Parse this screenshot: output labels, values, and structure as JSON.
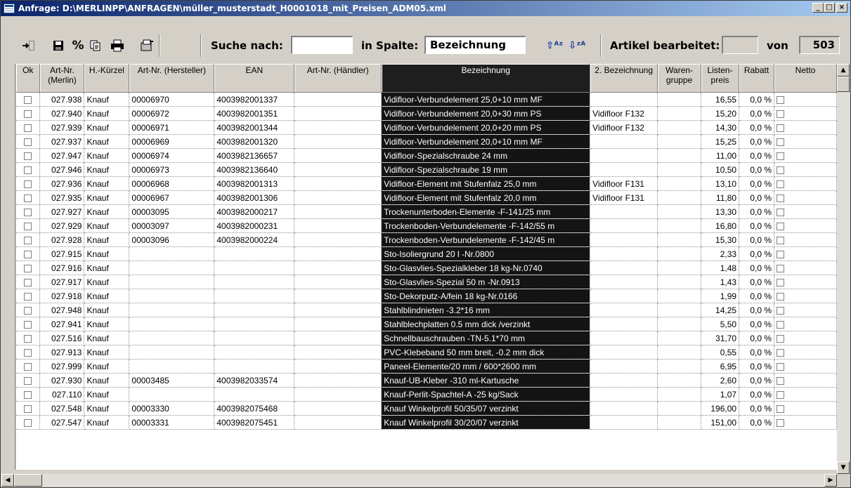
{
  "window": {
    "title": "Anfrage: D:\\MERLINPP\\ANFRAGEN\\müller_musterstadt_H0001018_mit_Preisen_ADM05.xml"
  },
  "toolbar": {
    "search_label": "Suche nach:",
    "search_value": "",
    "column_label": "in Spalte:",
    "column_value": "Bezeichnung",
    "edited_label": "Artikel bearbeitet:",
    "edited_value": "",
    "of_label": "von",
    "total": "503",
    "icons": [
      "exit-icon",
      "save-icon",
      "percent-icon",
      "copy-icon",
      "print-icon",
      "export-icon",
      "sort-ascending-icon",
      "sort-descending-icon"
    ]
  },
  "grid": {
    "columns": [
      "Ok",
      "Art-Nr. (Merlin)",
      "H.-Kürzel",
      "Art-Nr. (Hersteller)",
      "EAN",
      "Art-Nr. (Händler)",
      "Bezeichnung",
      "2. Bezeichnung",
      "Waren- gruppe",
      "Listen- preis",
      "Rabatt",
      "Netto"
    ],
    "rows": [
      {
        "art": "027.938",
        "hk": "Knauf",
        "hersteller": "00006970",
        "ean": "4003982001337",
        "haendler": "",
        "bez": "Vidifloor-Verbundelement 25,0+10 mm MF",
        "bez2": "",
        "wg": "",
        "preis": "16,55",
        "rabatt": "0,0 %"
      },
      {
        "art": "027.940",
        "hk": "Knauf",
        "hersteller": "00006972",
        "ean": "4003982001351",
        "haendler": "",
        "bez": "Vidifloor-Verbundelement 20,0+30 mm PS",
        "bez2": "Vidifloor F132",
        "wg": "",
        "preis": "15,20",
        "rabatt": "0,0 %"
      },
      {
        "art": "027.939",
        "hk": "Knauf",
        "hersteller": "00006971",
        "ean": "4003982001344",
        "haendler": "",
        "bez": "Vidifloor-Verbundelement 20,0+20 mm PS",
        "bez2": "Vidifloor F132",
        "wg": "",
        "preis": "14,30",
        "rabatt": "0,0 %"
      },
      {
        "art": "027.937",
        "hk": "Knauf",
        "hersteller": "00006969",
        "ean": "4003982001320",
        "haendler": "",
        "bez": "Vidifloor-Verbundelement 20,0+10 mm MF",
        "bez2": "",
        "wg": "",
        "preis": "15,25",
        "rabatt": "0,0 %"
      },
      {
        "art": "027.947",
        "hk": "Knauf",
        "hersteller": "00006974",
        "ean": "4003982136657",
        "haendler": "",
        "bez": "Vidifloor-Spezialschraube 24 mm",
        "bez2": "",
        "wg": "",
        "preis": "11,00",
        "rabatt": "0,0 %"
      },
      {
        "art": "027.946",
        "hk": "Knauf",
        "hersteller": "00006973",
        "ean": "4003982136640",
        "haendler": "",
        "bez": "Vidifloor-Spezialschraube 19 mm",
        "bez2": "",
        "wg": "",
        "preis": "10,50",
        "rabatt": "0,0 %"
      },
      {
        "art": "027.936",
        "hk": "Knauf",
        "hersteller": "00006968",
        "ean": "4003982001313",
        "haendler": "",
        "bez": "Vidifloor-Element mit Stufenfalz 25,0 mm",
        "bez2": "Vidifloor F131",
        "wg": "",
        "preis": "13,10",
        "rabatt": "0,0 %"
      },
      {
        "art": "027.935",
        "hk": "Knauf",
        "hersteller": "00006967",
        "ean": "4003982001306",
        "haendler": "",
        "bez": "Vidifloor-Element mit Stufenfalz 20,0 mm",
        "bez2": "Vidifloor F131",
        "wg": "",
        "preis": "11,80",
        "rabatt": "0,0 %"
      },
      {
        "art": "027.927",
        "hk": "Knauf",
        "hersteller": "00003095",
        "ean": "4003982000217",
        "haendler": "",
        "bez": "Trockenunterboden-Elemente   -F-141/25 mm",
        "bez2": "",
        "wg": "",
        "preis": "13,30",
        "rabatt": "0,0 %"
      },
      {
        "art": "027.929",
        "hk": "Knauf",
        "hersteller": "00003097",
        "ean": "4003982000231",
        "haendler": "",
        "bez": "Trockenboden-Verbundelemente  -F-142/55 m",
        "bez2": "",
        "wg": "",
        "preis": "16,80",
        "rabatt": "0,0 %"
      },
      {
        "art": "027.928",
        "hk": "Knauf",
        "hersteller": "00003096",
        "ean": "4003982000224",
        "haendler": "",
        "bez": "Trockenboden-Verbundelemente  -F-142/45 m",
        "bez2": "",
        "wg": "",
        "preis": "15,30",
        "rabatt": "0,0 %"
      },
      {
        "art": "027.915",
        "hk": "Knauf",
        "hersteller": "",
        "ean": "",
        "haendler": "",
        "bez": "Sto-Isoliergrund              20 l -Nr.0800",
        "bez2": "",
        "wg": "",
        "preis": "2,33",
        "rabatt": "0,0 %"
      },
      {
        "art": "027.916",
        "hk": "Knauf",
        "hersteller": "",
        "ean": "",
        "haendler": "",
        "bez": "Sto-Glasvlies-Spezialkleber  18 kg-Nr.0740",
        "bez2": "",
        "wg": "",
        "preis": "1,48",
        "rabatt": "0,0 %"
      },
      {
        "art": "027.917",
        "hk": "Knauf",
        "hersteller": "",
        "ean": "",
        "haendler": "",
        "bez": "Sto-Glasvlies-Spezial      50 m -Nr.0913",
        "bez2": "",
        "wg": "",
        "preis": "1,43",
        "rabatt": "0,0 %"
      },
      {
        "art": "027.918",
        "hk": "Knauf",
        "hersteller": "",
        "ean": "",
        "haendler": "",
        "bez": "Sto-Dekorputz-A/fein        18 kg-Nr.0166",
        "bez2": "",
        "wg": "",
        "preis": "1,99",
        "rabatt": "0,0 %"
      },
      {
        "art": "027.948",
        "hk": "Knauf",
        "hersteller": "",
        "ean": "",
        "haendler": "",
        "bez": "Stahlblindnieten              -3.2*16 mm",
        "bez2": "",
        "wg": "",
        "preis": "14,25",
        "rabatt": "0,0 %"
      },
      {
        "art": "027.941",
        "hk": "Knauf",
        "hersteller": "",
        "ean": "",
        "haendler": "",
        "bez": "Stahlblechplatten 0.5 mm dick   /verzinkt",
        "bez2": "",
        "wg": "",
        "preis": "5,50",
        "rabatt": "0,0 %"
      },
      {
        "art": "027.516",
        "hk": "Knauf",
        "hersteller": "",
        "ean": "",
        "haendler": "",
        "bez": "Schnellbauschrauben         -TN-5.1*70 mm",
        "bez2": "",
        "wg": "",
        "preis": "31,70",
        "rabatt": "0,0 %"
      },
      {
        "art": "027.913",
        "hk": "Knauf",
        "hersteller": "",
        "ean": "",
        "haendler": "",
        "bez": "PVC-Klebeband 50 mm breit,   -0.2 mm dick",
        "bez2": "",
        "wg": "",
        "preis": "0,55",
        "rabatt": "0,0 %"
      },
      {
        "art": "027.999",
        "hk": "Knauf",
        "hersteller": "",
        "ean": "",
        "haendler": "",
        "bez": "Paneel-Elemente/20 mm       / 600*2600 mm",
        "bez2": "",
        "wg": "",
        "preis": "6,95",
        "rabatt": "0,0 %"
      },
      {
        "art": "027.930",
        "hk": "Knauf",
        "hersteller": "00003485",
        "ean": "4003982033574",
        "haendler": "",
        "bez": "Knauf-UB-Kleber          -310 ml-Kartusche",
        "bez2": "",
        "wg": "",
        "preis": "2,60",
        "rabatt": "0,0 %"
      },
      {
        "art": "027.110",
        "hk": "Knauf",
        "hersteller": "",
        "ean": "",
        "haendler": "",
        "bez": "Knauf-Perlit-Spachtel-A    -25 kg/Sack",
        "bez2": "",
        "wg": "",
        "preis": "1,07",
        "rabatt": "0,0 %"
      },
      {
        "art": "027.548",
        "hk": "Knauf",
        "hersteller": "00003330",
        "ean": "4003982075468",
        "haendler": "",
        "bez": "Knauf Winkelprofil 50/35/07 verzinkt",
        "bez2": "",
        "wg": "",
        "preis": "196,00",
        "rabatt": "0,0 %"
      },
      {
        "art": "027.547",
        "hk": "Knauf",
        "hersteller": "00003331",
        "ean": "4003982075451",
        "haendler": "",
        "bez": "Knauf Winkelprofil 30/20/07 verzinkt",
        "bez2": "",
        "wg": "",
        "preis": "151,00",
        "rabatt": "0,0 %"
      }
    ]
  }
}
